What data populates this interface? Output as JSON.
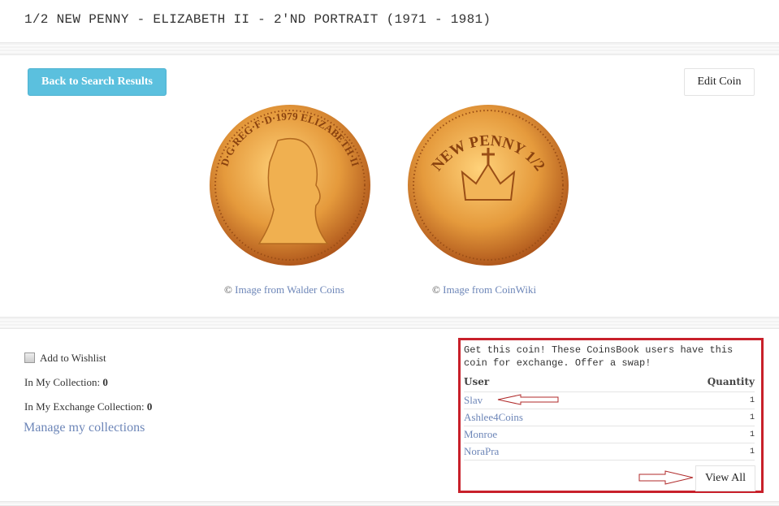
{
  "header": {
    "title": "1/2 NEW PENNY - ELIZABETH II - 2'ND PORTRAIT (1971 - 1981)"
  },
  "toolbar": {
    "back_label": "Back to Search Results",
    "edit_label": "Edit Coin"
  },
  "images": [
    {
      "side": "obverse",
      "copyright": "©",
      "credit": "Image from Walder Coins",
      "legend": "D·G·REG·F·D·1979 ELIZABETH·II"
    },
    {
      "side": "reverse",
      "copyright": "©",
      "credit": "Image from CoinWiki",
      "legend": "NEW PENNY 1/2"
    }
  ],
  "collection": {
    "wishlist_label": "Add to Wishlist",
    "wishlist_checked": false,
    "in_collection_label": "In My Collection:",
    "in_collection_value": "0",
    "in_exchange_label": "In My Exchange Collection:",
    "in_exchange_value": "0",
    "manage_link": "Manage my collections"
  },
  "exchange": {
    "intro": "Get this coin! These CoinsBook users have this coin for exchange. Offer a swap!",
    "columns": [
      "User",
      "Quantity"
    ],
    "rows": [
      {
        "user": "Slav",
        "quantity": "1"
      },
      {
        "user": "Ashlee4Coins",
        "quantity": "1"
      },
      {
        "user": "Monroe",
        "quantity": "1"
      },
      {
        "user": "NoraPra",
        "quantity": "1"
      }
    ],
    "view_all_label": "View All",
    "highlight_color": "#c8202a"
  },
  "colors": {
    "accent": "#5bc0de",
    "link": "#6d86b8"
  }
}
